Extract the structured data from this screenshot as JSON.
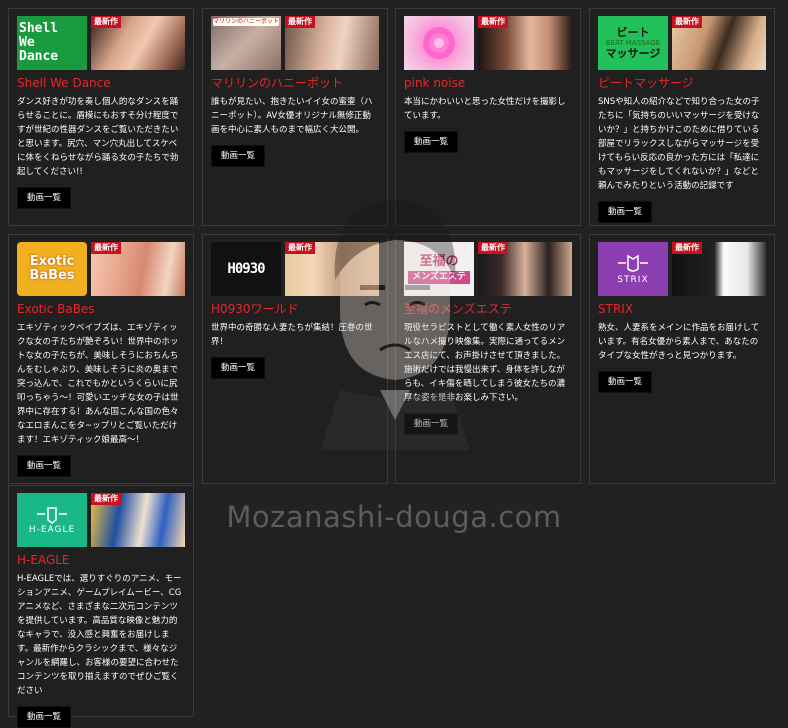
{
  "badge_label": "最新作",
  "button_label": "動画一覧",
  "watermark": "Mozanashi-douga.com",
  "cards": [
    {
      "title": "Shell We Dance",
      "logo_text": [
        "Shell",
        "We",
        "Dance"
      ],
      "description": "ダンス好きが功を奏し個人的なダンスを踊らせることに。盾模にもおすそ分け程度ですが世紀の性器ダンスをご覧いただきたいと思います。尻穴、マン穴丸出してスケベに体をくねらせながら踊る女の子たちで勃起してください!!"
    },
    {
      "title": "マリリンのハニーポット",
      "logo_text": [
        "マリリンのハニーポット"
      ],
      "description": "誰もが見たい、抱きたいイイ女の蜜壷（ハニーポット）。AV女優オリジナル無修正動画を中心に素人ものまで幅広く大公開。"
    },
    {
      "title": "pink noise",
      "logo_text": [],
      "description": "本当にかわいいと思った女性だけを撮影しています。"
    },
    {
      "title": "ビートマッサージ",
      "logo_text": [
        "ビート",
        "BEAT MASSAGE",
        "マッサージ"
      ],
      "description": "SNSや知人の紹介などで知り合った女の子たちに「気持ちのいいマッサージを受けないか？」と持ちかけこのために借りている部屋でリラックスしながらマッサージを受けてもらい反応の良かった方には「私達にもマッサージをしてくれないか？」などと頼んでみたりという活動の記録です"
    },
    {
      "title": "Exotic BaBes",
      "logo_text": [
        "Exotic",
        "BaBes"
      ],
      "description": "エキゾティックベイブズは、エキゾティックな女の子たちが艶ぞろい！世界中のホットな女の子たちが、美味しそうにおちんちんをむしゃぶり、美味しそうに炎の奥まで突っ込んで、これでもかというくらいに尻叩っちゃう～！可愛いエッチな女の子は世界中に存在する！あんな国こんな国の色々なエロまんこをタ~ップリとご覧いただけます！エキゾティック娘最高～！"
    },
    {
      "title": "H0930ワールド",
      "logo_text": [
        "H0930"
      ],
      "description": "世界中の奇勝な人妻たちが集結！圧巻の世界！"
    },
    {
      "title": "至福のメンズエステ",
      "logo_text": [
        "至福の",
        "メンズエステ"
      ],
      "description": "現役セラピストとして働く素人女性のリアルなハメ撮り映像集。実際に通ってるメンエス店にて、お声掛けさせて頂きました。施術だけでは我慢出来ず、身体を許しながらも、イキ傷を晒してしまう彼女たちの濃厚な姿を是非お楽しみ下さい。"
    },
    {
      "title": "STRIX",
      "logo_text": [
        "STRIX"
      ],
      "description": "熟女、人妻系をメインに作品をお届けしています。有名女優から素人まで、あなたのタイプな女性がきっと見つかります。"
    },
    {
      "title": "H-EAGLE",
      "logo_text": [
        "H-EAGLE"
      ],
      "description": "H-EAGLEでは、選りすぐりのアニメ、モーションアニメ、ゲームプレイムービー、CGアニメなど、さまざまな二次元コンテンツを提供しています。高品質な映像と魅力的なキャラで、没入感と興奮をお届けします。最新作からクラシックまで、様々なジャンルを網羅し、お客様の要望に合わせたコンテンツを取り揃えますのでぜひご覧ください"
    }
  ]
}
